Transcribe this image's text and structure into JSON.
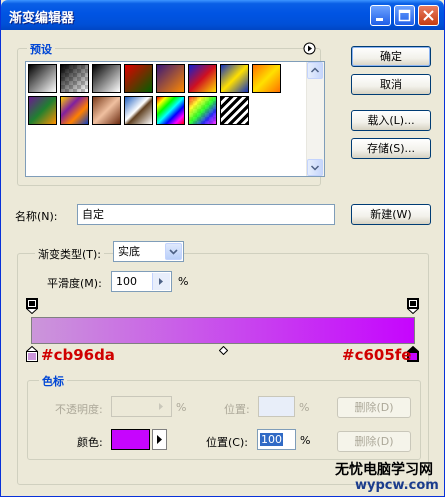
{
  "window": {
    "title": "渐变编辑器"
  },
  "presets": {
    "label": "预设",
    "swatches": [
      {
        "name": "foreground-to-background",
        "bg": "linear-gradient(135deg, #000000 0%, #ffffff 100%)"
      },
      {
        "name": "foreground-to-transparent",
        "bg": "linear-gradient(135deg, #000000 0%, rgba(0,0,0,0) 100%), repeating-conic-gradient(#c8c8c8 0% 25%, #ffffff 0% 50%) 0 0 / 8px 8px"
      },
      {
        "name": "black-white",
        "bg": "linear-gradient(135deg, #000000 0%, #ffffff 100%)"
      },
      {
        "name": "red-green",
        "bg": "linear-gradient(135deg, #e00000 0%, #006000 100%)"
      },
      {
        "name": "violet-orange",
        "bg": "linear-gradient(135deg, #3a1878 0%, #ff8a00 100%)"
      },
      {
        "name": "blue-red-yellow",
        "bg": "linear-gradient(135deg, #1020d0 0%, #d01020 50%, #ffe000 100%)"
      },
      {
        "name": "blue-yellow-blue",
        "bg": "linear-gradient(135deg, #1030c0 0%, #ffe000 50%, #1030c0 100%)"
      },
      {
        "name": "orange-yellow-orange",
        "bg": "linear-gradient(135deg, #ff7000 0%, #ffe000 50%, #ff7000 100%)"
      },
      {
        "name": "violet-green-orange",
        "bg": "linear-gradient(135deg, #6a1a90 0%, #208030 50%, #ff9000 100%)"
      },
      {
        "name": "yellow-violet-orange-blue",
        "bg": "linear-gradient(135deg, #ffd000 0%, #8020a0 35%, #ff8000 65%, #1040c0 100%)"
      },
      {
        "name": "copper",
        "bg": "linear-gradient(135deg, #7a3a1a 0%, #f0c0a0 50%, #6a2a10 100%)"
      },
      {
        "name": "chrome",
        "bg": "linear-gradient(135deg, #2060c0 0%, #ffffff 45%, #604020 55%, #ffffff 100%)"
      },
      {
        "name": "spectrum",
        "bg": "linear-gradient(135deg, #ff0000, #ffff00, #00ff00, #00ffff, #0000ff, #ff00ff, #ff0000)"
      },
      {
        "name": "transparent-rainbow",
        "bg": "linear-gradient(135deg, rgba(255,0,0,0.8), rgba(255,255,0,0.8), rgba(0,255,0,0.8), rgba(0,0,255,0.8), rgba(255,0,255,0.8)), repeating-conic-gradient(#c8c8c8 0% 25%, #ffffff 0% 50%) 0 0 / 8px 8px"
      },
      {
        "name": "transparent-stripes",
        "bg": "repeating-linear-gradient(135deg, #000000 0 3px, #ffffff 3px 6px)"
      }
    ]
  },
  "buttons": {
    "ok": "确定",
    "cancel": "取消",
    "load": "载入(L)...",
    "save": "存储(S)...",
    "new": "新建(W)"
  },
  "name_row": {
    "label": "名称(N):",
    "value": "自定"
  },
  "gradient_type": {
    "label": "渐变类型(T):",
    "value": "实底"
  },
  "smoothness": {
    "label": "平滑度(M):",
    "value": "100",
    "unit": "%"
  },
  "gradient": {
    "start_color": "#cb96da",
    "end_color": "#c605fe"
  },
  "annotations": {
    "start_hex": "#cb96da",
    "end_hex": "#c605fe"
  },
  "color_stops": {
    "label": "色标",
    "opacity_label": "不透明度:",
    "opacity_unit": "%",
    "opacity_location_label": "位置:",
    "opacity_location_unit": "%",
    "delete_label": "删除(D)",
    "color_label": "颜色:",
    "color_value": "#c605fe",
    "location_label": "位置(C):",
    "location_value": "100",
    "location_unit": "%"
  },
  "watermark": {
    "line1": "无忧电脑学习网",
    "line2": "wypcw.com"
  }
}
